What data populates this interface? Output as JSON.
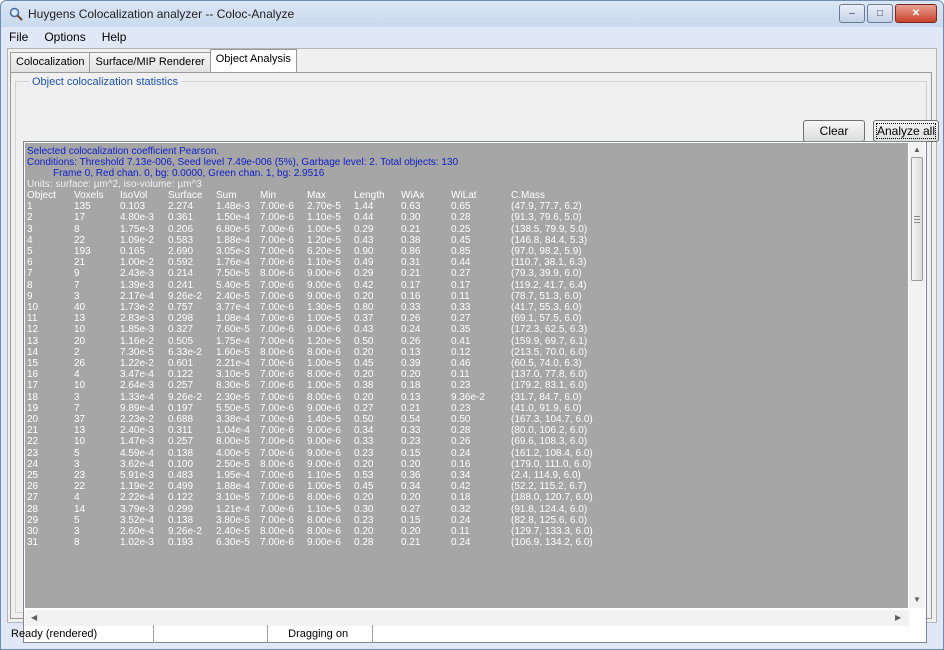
{
  "window": {
    "title": "Huygens Colocalization analyzer -- Coloc-Analyze",
    "controls": {
      "minimize": "–",
      "maximize": "□",
      "close": "✕"
    }
  },
  "menu": [
    "File",
    "Options",
    "Help"
  ],
  "tabs": [
    "Colocalization",
    "Surface/MIP Renderer",
    "Object Analysis"
  ],
  "active_tab": "Object Analysis",
  "group_title": "Object colocalization statistics",
  "buttons": {
    "clear": "Clear",
    "analyze_all": "Analyze all"
  },
  "output": {
    "header_lines": [
      "Selected colocalization coefficient Pearson.",
      "Conditions: Threshold 7.13e-006, Seed level 7.49e-006 (5%), Garbage level: 2. Total objects: 130",
      "Frame 0, Red chan. 0, bg: 0.0000, Green chan. 1, bg: 2.9516"
    ],
    "units_line": "Units: surface: µm^2, iso-volume: µm^3",
    "columns": [
      "Object",
      "Voxels",
      "IsoVol",
      "Surface",
      "Sum",
      "Min",
      "Max",
      "Length",
      "WiAx",
      "WiLat",
      "C.Mass"
    ],
    "rows": [
      [
        "1",
        "135",
        "0.103",
        "2.274",
        "1.48e-3",
        "7.00e-6",
        "2.70e-5",
        "1.44",
        "0.63",
        "0.65",
        "(47.9, 77.7, 6.2)"
      ],
      [
        "2",
        "17",
        "4.80e-3",
        "0.361",
        "1.50e-4",
        "7.00e-6",
        "1.10e-5",
        "0.44",
        "0.30",
        "0.28",
        "(91.3, 79.6, 5.0)"
      ],
      [
        "3",
        "8",
        "1.75e-3",
        "0.206",
        "6.80e-5",
        "7.00e-6",
        "1.00e-5",
        "0.29",
        "0.21",
        "0.25",
        "(138.5, 79.9, 5.0)"
      ],
      [
        "4",
        "22",
        "1.09e-2",
        "0.583",
        "1.88e-4",
        "7.00e-6",
        "1.20e-5",
        "0.43",
        "0.38",
        "0.45",
        "(146.8, 84.4, 5.3)"
      ],
      [
        "5",
        "193",
        "0.165",
        "2.690",
        "3.05e-3",
        "7.00e-6",
        "6.20e-5",
        "0.90",
        "0.86",
        "0.85",
        "(97.0, 98.2, 5.9)"
      ],
      [
        "6",
        "21",
        "1.00e-2",
        "0.592",
        "1.76e-4",
        "7.00e-6",
        "1.10e-5",
        "0.49",
        "0.31",
        "0.44",
        "(110.7, 38.1, 6.3)"
      ],
      [
        "7",
        "9",
        "2.43e-3",
        "0.214",
        "7.50e-5",
        "8.00e-6",
        "9.00e-6",
        "0.29",
        "0.21",
        "0.27",
        "(79.3, 39.9, 6.0)"
      ],
      [
        "8",
        "7",
        "1.39e-3",
        "0.241",
        "5.40e-5",
        "7.00e-6",
        "9.00e-6",
        "0.42",
        "0.17",
        "0.17",
        "(119.2, 41.7, 6.4)"
      ],
      [
        "9",
        "3",
        "2.17e-4",
        "9.26e-2",
        "2.40e-5",
        "7.00e-6",
        "9.00e-6",
        "0.20",
        "0.16",
        "0.11",
        "(78.7, 51.3, 6.0)"
      ],
      [
        "10",
        "40",
        "1.73e-2",
        "0.757",
        "3.77e-4",
        "7.00e-6",
        "1.30e-5",
        "0.80",
        "0.33",
        "0.33",
        "(41.7, 55.3, 6.0)"
      ],
      [
        "11",
        "13",
        "2.83e-3",
        "0.298",
        "1.08e-4",
        "7.00e-6",
        "1.00e-5",
        "0.37",
        "0.26",
        "0.27",
        "(69.1, 57.5, 6.0)"
      ],
      [
        "12",
        "10",
        "1.85e-3",
        "0.327",
        "7.60e-5",
        "7.00e-6",
        "9.00e-6",
        "0.43",
        "0.24",
        "0.35",
        "(172.3, 62.5, 6.3)"
      ],
      [
        "13",
        "20",
        "1.16e-2",
        "0.505",
        "1.75e-4",
        "7.00e-6",
        "1.20e-5",
        "0.50",
        "0.26",
        "0.41",
        "(159.9, 69.7, 6.1)"
      ],
      [
        "14",
        "2",
        "7.30e-5",
        "6.33e-2",
        "1.60e-5",
        "8.00e-6",
        "8.00e-6",
        "0.20",
        "0.13",
        "0.12",
        "(213.5, 70.0, 6.0)"
      ],
      [
        "15",
        "26",
        "1.22e-2",
        "0.601",
        "2.21e-4",
        "7.00e-6",
        "1.00e-5",
        "0.45",
        "0.39",
        "0.46",
        "(60.5, 74.0, 6.3)"
      ],
      [
        "16",
        "4",
        "3.47e-4",
        "0.122",
        "3.10e-5",
        "7.00e-6",
        "8.00e-6",
        "0.20",
        "0.20",
        "0.11",
        "(137.0, 77.8, 6.0)"
      ],
      [
        "17",
        "10",
        "2.64e-3",
        "0.257",
        "8.30e-5",
        "7.00e-6",
        "1.00e-5",
        "0.38",
        "0.18",
        "0.23",
        "(179.2, 83.1, 6.0)"
      ],
      [
        "18",
        "3",
        "1.33e-4",
        "9.26e-2",
        "2.30e-5",
        "7.00e-6",
        "8.00e-6",
        "0.20",
        "0.13",
        "9.36e-2",
        "(31.7, 84.7, 6.0)"
      ],
      [
        "19",
        "7",
        "9.89e-4",
        "0.197",
        "5.50e-5",
        "7.00e-6",
        "9.00e-6",
        "0.27",
        "0.21",
        "0.23",
        "(41.0, 91.9, 6.0)"
      ],
      [
        "20",
        "37",
        "2.23e-2",
        "0.688",
        "3.38e-4",
        "7.00e-6",
        "1.40e-5",
        "0.50",
        "0.54",
        "0.50",
        "(167.3, 104.7, 6.0)"
      ],
      [
        "21",
        "13",
        "2.40e-3",
        "0.311",
        "1.04e-4",
        "7.00e-6",
        "9.00e-6",
        "0.34",
        "0.33",
        "0.28",
        "(80.0, 106.2, 6.0)"
      ],
      [
        "22",
        "10",
        "1.47e-3",
        "0.257",
        "8.00e-5",
        "7.00e-6",
        "9.00e-6",
        "0.33",
        "0.23",
        "0.26",
        "(69.6, 108.3, 6.0)"
      ],
      [
        "23",
        "5",
        "4.59e-4",
        "0.138",
        "4.00e-5",
        "7.00e-6",
        "9.00e-6",
        "0.23",
        "0.15",
        "0.24",
        "(161.2, 108.4, 6.0)"
      ],
      [
        "24",
        "3",
        "3.62e-4",
        "0.100",
        "2.50e-5",
        "8.00e-6",
        "9.00e-6",
        "0.20",
        "0.20",
        "0.16",
        "(179.0, 111.0, 6.0)"
      ],
      [
        "25",
        "23",
        "5.91e-3",
        "0.483",
        "1.95e-4",
        "7.00e-6",
        "1.10e-5",
        "0.53",
        "0.36",
        "0.34",
        "(2.4, 114.9, 6.0)"
      ],
      [
        "26",
        "22",
        "1.19e-2",
        "0.499",
        "1.88e-4",
        "7.00e-6",
        "1.00e-5",
        "0.45",
        "0.34",
        "0.42",
        "(52.2, 115.2, 6.7)"
      ],
      [
        "27",
        "4",
        "2.22e-4",
        "0.122",
        "3.10e-5",
        "7.00e-6",
        "8.00e-6",
        "0.20",
        "0.20",
        "0.18",
        "(188.0, 120.7, 6.0)"
      ],
      [
        "28",
        "14",
        "3.79e-3",
        "0.299",
        "1.21e-4",
        "7.00e-6",
        "1.10e-5",
        "0.30",
        "0.27",
        "0.32",
        "(91.8, 124.4, 6.0)"
      ],
      [
        "29",
        "5",
        "3.52e-4",
        "0.138",
        "3.80e-5",
        "7.00e-6",
        "8.00e-6",
        "0.23",
        "0.15",
        "0.24",
        "(82.8, 125.6, 6.0)"
      ],
      [
        "30",
        "3",
        "2.60e-4",
        "9.26e-2",
        "2.40e-5",
        "8.00e-6",
        "8.00e-6",
        "0.20",
        "0.20",
        "0.11",
        "(129.7, 133.3, 6.0)"
      ],
      [
        "31",
        "8",
        "1.02e-3",
        "0.193",
        "6.30e-5",
        "7.00e-6",
        "9.00e-6",
        "0.28",
        "0.21",
        "0.24",
        "(106.9, 134.2, 6.0)"
      ]
    ]
  },
  "status": [
    "Ready (rendered)",
    "",
    "Dragging on",
    ""
  ],
  "icons": {
    "app": "magnifier-icon"
  },
  "colors": {
    "header_text": "#1020c8",
    "table_bg": "#a6a6a6",
    "table_text": "#ffffff",
    "group_title": "#1e50b4"
  }
}
